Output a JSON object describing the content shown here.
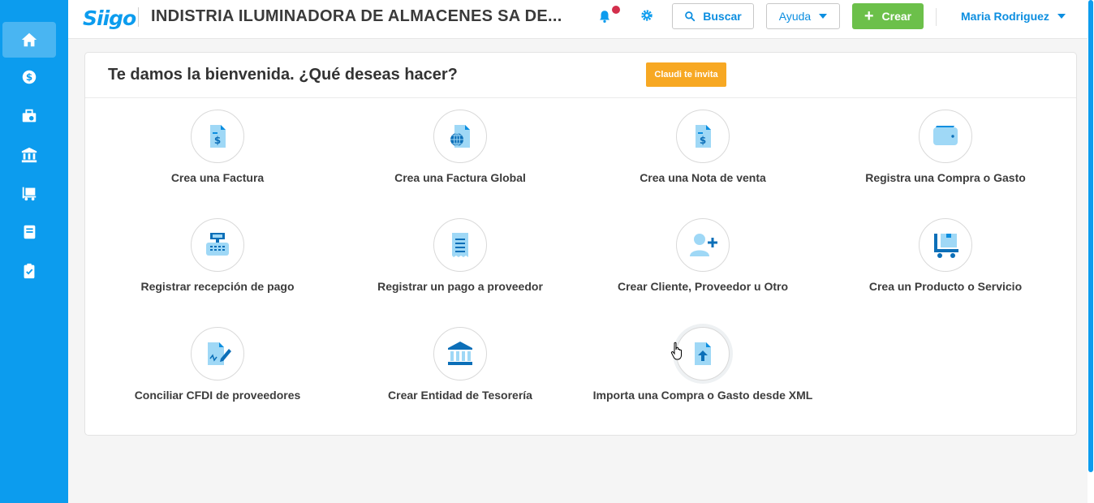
{
  "header": {
    "logo": "Siigo",
    "company": "INDISTRIA ILUMINADORA DE ALMACENES SA DE...",
    "search_label": "Buscar",
    "help_label": "Ayuda",
    "create_label": "Crear",
    "user_name": "Maria Rodriguez"
  },
  "sidebar": {
    "items": [
      {
        "icon": "home-icon",
        "active": true
      },
      {
        "icon": "dollar-icon"
      },
      {
        "icon": "briefcase-icon"
      },
      {
        "icon": "bank-icon"
      },
      {
        "icon": "truck-box-icon"
      },
      {
        "icon": "book-icon"
      },
      {
        "icon": "clipboard-check-icon"
      }
    ]
  },
  "main": {
    "welcome": "Te damos la bienvenida. ¿Qué deseas hacer?",
    "invite_label": "Claudi te invita",
    "actions": [
      {
        "label": "Crea una Factura",
        "icon": "invoice-icon"
      },
      {
        "label": "Crea una Factura Global",
        "icon": "global-invoice-icon"
      },
      {
        "label": "Crea una Nota de venta",
        "icon": "sales-note-icon"
      },
      {
        "label": "Registra una Compra o Gasto",
        "icon": "wallet-icon"
      },
      {
        "label": "Registrar recepción de pago",
        "icon": "cash-register-icon"
      },
      {
        "label": "Registrar un pago a proveedor",
        "icon": "receipt-icon"
      },
      {
        "label": "Crear Cliente, Proveedor u Otro",
        "icon": "add-user-icon"
      },
      {
        "label": "Crea un Producto o Servicio",
        "icon": "product-cart-icon"
      },
      {
        "label": "Conciliar CFDI de proveedores",
        "icon": "signed-document-icon"
      },
      {
        "label": "Crear Entidad de Tesorería",
        "icon": "bank-icon"
      },
      {
        "label": "Importa una Compra o Gasto desde XML",
        "icon": "upload-file-icon"
      }
    ]
  },
  "colors": {
    "primary": "#0c9cee",
    "accent_green": "#6cc04a",
    "invite_orange": "#f7a823",
    "notification_red": "#d32f4c"
  }
}
